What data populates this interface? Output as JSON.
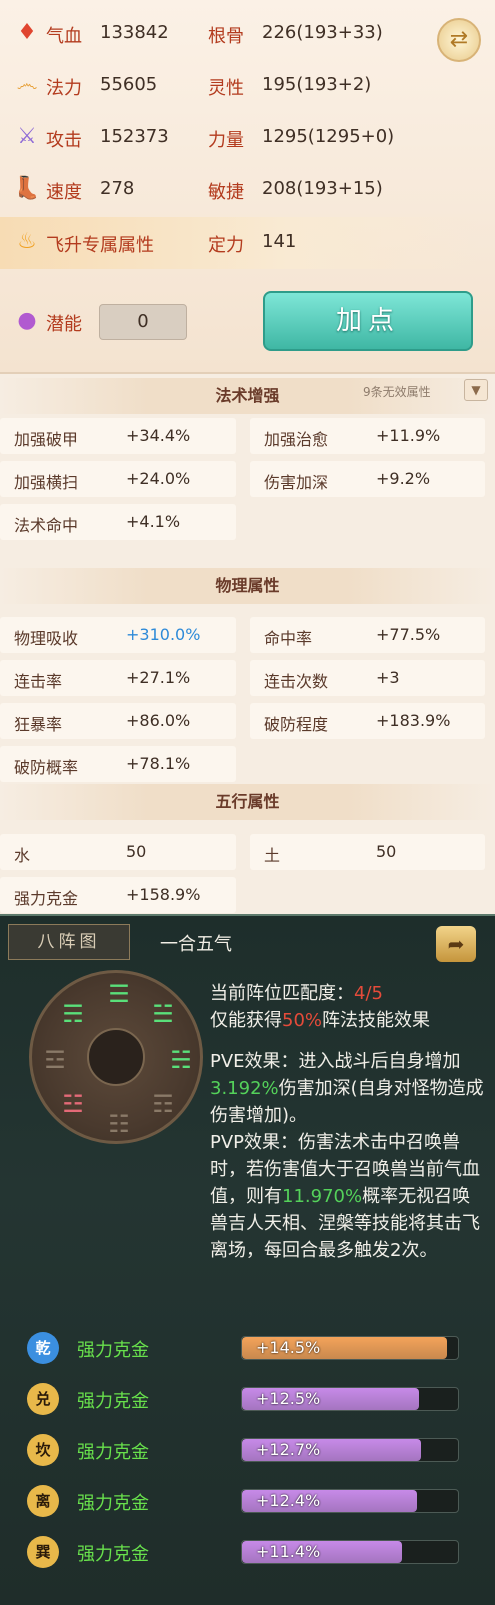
{
  "stats": {
    "hp_label": "气血",
    "hp_value": "133842",
    "mp_label": "法力",
    "mp_value": "55605",
    "atk_label": "攻击",
    "atk_value": "152373",
    "spd_label": "速度",
    "spd_value": "278",
    "ascend_label": "飞升专属属性",
    "potential_label": "潜能",
    "potential_value": "0",
    "gengu_label": "根骨",
    "gengu_value": "226(193+33)",
    "lingxing_label": "灵性",
    "lingxing_value": "195(193+2)",
    "liliang_label": "力量",
    "liliang_value": "1295(1295+0)",
    "minjie_label": "敏捷",
    "minjie_value": "208(193+15)",
    "dingli_label": "定力",
    "dingli_value": "141",
    "add_points_label": "加点"
  },
  "spell": {
    "title": "法术增强",
    "invalid_note": "9条无效属性",
    "items": [
      {
        "k": "加强破甲",
        "v": "+34.4%"
      },
      {
        "k": "加强治愈",
        "v": "+11.9%"
      },
      {
        "k": "加强横扫",
        "v": "+24.0%"
      },
      {
        "k": "伤害加深",
        "v": "+9.2%"
      },
      {
        "k": "法术命中",
        "v": "+4.1%"
      }
    ]
  },
  "physical": {
    "title": "物理属性",
    "items": [
      {
        "k": "物理吸收",
        "v": "+310.0%"
      },
      {
        "k": "命中率",
        "v": "+77.5%"
      },
      {
        "k": "连击率",
        "v": "+27.1%"
      },
      {
        "k": "连击次数",
        "v": "+3"
      },
      {
        "k": "狂暴率",
        "v": "+86.0%"
      },
      {
        "k": "破防程度",
        "v": "+183.9%"
      },
      {
        "k": "破防概率",
        "v": "+78.1%"
      }
    ]
  },
  "wuxing": {
    "title": "五行属性",
    "items": [
      {
        "k": "水",
        "v": "50"
      },
      {
        "k": "土",
        "v": "50"
      },
      {
        "k": "强力克金",
        "v": "+158.9%"
      }
    ]
  },
  "formation": {
    "tab": "八阵图",
    "name": "一合五气",
    "match_prefix": "当前阵位匹配度：",
    "match_value": "4/5",
    "gain_prefix": "仅能获得",
    "gain_pct": "50%",
    "gain_suffix": "阵法技能效果",
    "pve_1": "PVE效果：进入战斗后自身增加",
    "pve_pct": "3.192%",
    "pve_2": "伤害加深(自身对怪物造成伤害增加)。",
    "pvp_1": "PVP效果：伤害法术击中召唤兽时，若伤害值大于召唤兽当前气血值，则有",
    "pvp_pct": "11.970%",
    "pvp_2": "概率无视召唤兽吉人天相、涅槃等技能将其击飞离场，每回合最多触发2次。",
    "bonuses": [
      {
        "badge": "乾",
        "name": "强力克金",
        "value": "+14.5%",
        "fill": 0.95,
        "color": "#f4a35a"
      },
      {
        "badge": "兑",
        "name": "强力克金",
        "value": "+12.5%",
        "fill": 0.82,
        "color": "#c78ae8"
      },
      {
        "badge": "坎",
        "name": "强力克金",
        "value": "+12.7%",
        "fill": 0.83,
        "color": "#c78ae8"
      },
      {
        "badge": "离",
        "name": "强力克金",
        "value": "+12.4%",
        "fill": 0.81,
        "color": "#c78ae8"
      },
      {
        "badge": "巽",
        "name": "强力克金",
        "value": "+11.4%",
        "fill": 0.74,
        "color": "#c78ae8"
      }
    ]
  }
}
